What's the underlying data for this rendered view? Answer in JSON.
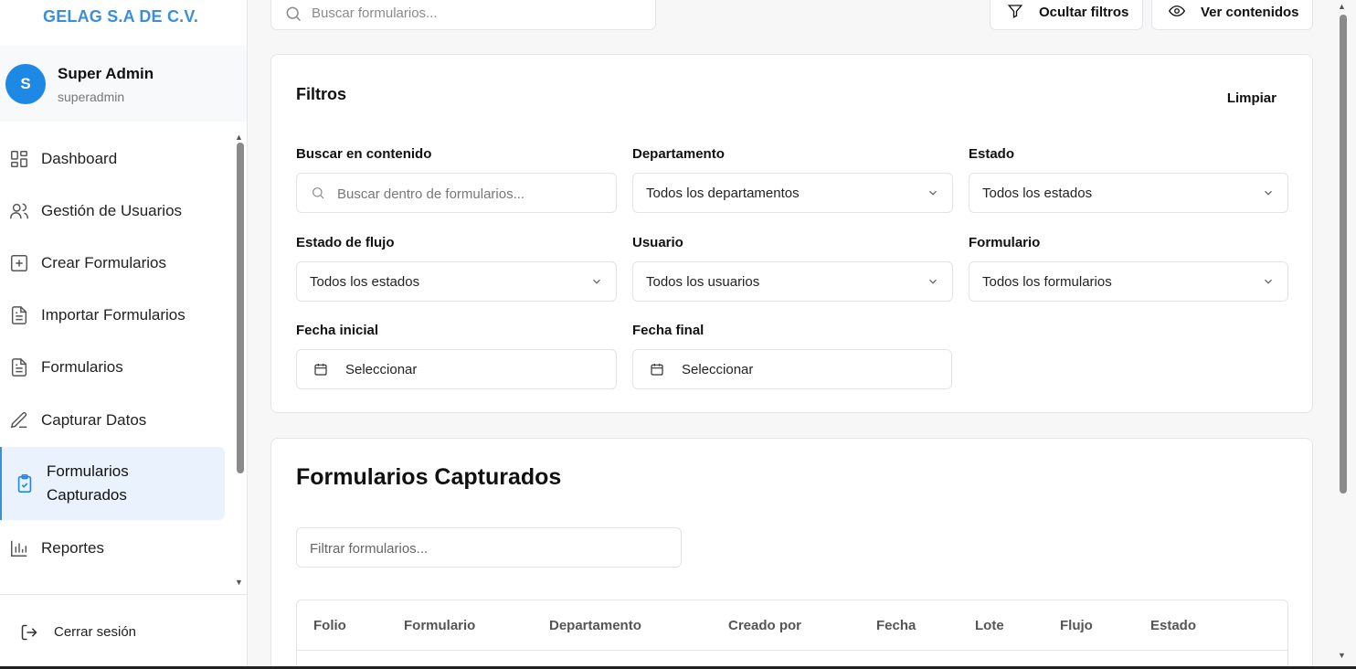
{
  "sidebar": {
    "brand": "GELAG S.A DE C.V.",
    "user": {
      "initial": "S",
      "name": "Super Admin",
      "handle": "superadmin"
    },
    "items": [
      {
        "label": "Dashboard",
        "icon": "dashboard-icon"
      },
      {
        "label": "Gestión de Usuarios",
        "icon": "users-icon"
      },
      {
        "label": "Crear Formularios",
        "icon": "plus-square-icon"
      },
      {
        "label": "Importar Formularios",
        "icon": "document-icon"
      },
      {
        "label": "Formularios",
        "icon": "document-icon"
      },
      {
        "label": "Capturar Datos",
        "icon": "pencil-icon"
      },
      {
        "label": "Formularios Capturados",
        "icon": "clipboard-check-icon",
        "active": true
      },
      {
        "label": "Reportes",
        "icon": "bar-chart-icon"
      }
    ],
    "logout": "Cerrar sesión"
  },
  "topbar": {
    "search_placeholder": "Buscar formularios...",
    "hide_filters": "Ocultar filtros",
    "view_contents": "Ver contenidos"
  },
  "filters": {
    "title": "Filtros",
    "clear": "Limpiar",
    "content_search": {
      "label": "Buscar en contenido",
      "placeholder": "Buscar dentro de formularios..."
    },
    "department": {
      "label": "Departamento",
      "value": "Todos los departamentos"
    },
    "state": {
      "label": "Estado",
      "value": "Todos los estados"
    },
    "flow_state": {
      "label": "Estado de flujo",
      "value": "Todos los estados"
    },
    "user": {
      "label": "Usuario",
      "value": "Todos los usuarios"
    },
    "form": {
      "label": "Formulario",
      "value": "Todos los formularios"
    },
    "start_date": {
      "label": "Fecha inicial",
      "value": "Seleccionar"
    },
    "end_date": {
      "label": "Fecha final",
      "value": "Seleccionar"
    }
  },
  "captured": {
    "title": "Formularios Capturados",
    "filter_placeholder": "Filtrar formularios...",
    "columns": [
      "Folio",
      "Formulario",
      "Departamento",
      "Creado por",
      "Fecha",
      "Lote",
      "Flujo",
      "Estado"
    ]
  },
  "colors": {
    "accent": "#3b8fd9",
    "avatar": "#1e88e5",
    "active_bg": "#eaf3fd"
  }
}
